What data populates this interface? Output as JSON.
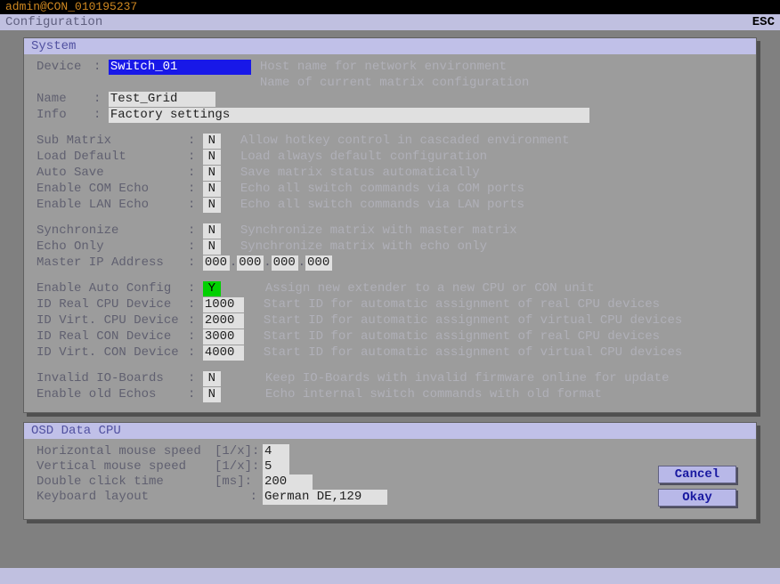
{
  "top_user": "admin@CON_010195237",
  "title": "Configuration",
  "esc": "ESC",
  "system": {
    "header": "System",
    "device_lbl": "Device",
    "device_val": "Switch_01",
    "device_desc1": "Host name for network environment",
    "device_desc2": "Name of current matrix configuration",
    "name_lbl": "Name",
    "name_val": "Test_Grid",
    "info_lbl": "Info",
    "info_val": "Factory settings",
    "submatrix_lbl": "Sub Matrix",
    "submatrix_val": "N",
    "submatrix_desc": "Allow hotkey control in cascaded environment",
    "loaddef_lbl": "Load Default",
    "loaddef_val": "N",
    "loaddef_desc": "Load always default configuration",
    "autosave_lbl": "Auto Save",
    "autosave_val": "N",
    "autosave_desc": "Save matrix status automatically",
    "comecho_lbl": "Enable COM Echo",
    "comecho_val": "N",
    "comecho_desc": "Echo all switch commands via COM ports",
    "lanecho_lbl": "Enable LAN Echo",
    "lanecho_val": "N",
    "lanecho_desc": "Echo all switch commands via LAN ports",
    "sync_lbl": "Synchronize",
    "sync_val": "N",
    "sync_desc": "Synchronize matrix with master matrix",
    "echoonly_lbl": "Echo Only",
    "echoonly_val": "N",
    "echoonly_desc": "Synchronize matrix with echo only",
    "masterip_lbl": "Master IP Address",
    "masterip": {
      "a": "000",
      "b": "000",
      "c": "000",
      "d": "000"
    },
    "autoconfig_lbl": "Enable Auto Config",
    "autoconfig_val": "Y",
    "autoconfig_desc": "Assign new extender to a new CPU or CON unit",
    "idrealcpu_lbl": "ID Real CPU Device",
    "idrealcpu_val": "1000",
    "idrealcpu_desc": "Start ID for automatic assignment of real CPU devices",
    "idvirtcpu_lbl": "ID Virt. CPU Device",
    "idvirtcpu_val": "2000",
    "idvirtcpu_desc": "Start ID for automatic assignment of virtual CPU devices",
    "idrealcon_lbl": "ID Real CON Device",
    "idrealcon_val": "3000",
    "idrealcon_desc": "Start ID for automatic assignment of real CPU devices",
    "idvirtcon_lbl": "ID Virt. CON Device",
    "idvirtcon_val": "4000",
    "idvirtcon_desc": "Start ID for automatic assignment of virtual CPU devices",
    "invalidio_lbl": "Invalid IO-Boards",
    "invalidio_val": "N",
    "invalidio_desc": "Keep IO-Boards with invalid firmware online for update",
    "oldechos_lbl": "Enable old Echos",
    "oldechos_val": "N",
    "oldechos_desc": "Echo internal switch commands with old format"
  },
  "osd": {
    "header": "OSD Data CPU",
    "hspeed_lbl": "Horizontal mouse speed",
    "hspeed_unit": "[1/x]:",
    "hspeed_val": "4",
    "vspeed_lbl": "Vertical mouse speed",
    "vspeed_unit": "[1/x]:",
    "vspeed_val": "5",
    "dblclick_lbl": "Double click time",
    "dblclick_unit": "[ms]:",
    "dblclick_val": "200",
    "kblayout_lbl": "Keyboard layout",
    "kblayout_unit": ":",
    "kblayout_val": "German DE,129"
  },
  "buttons": {
    "cancel": "Cancel",
    "okay": "Okay"
  }
}
